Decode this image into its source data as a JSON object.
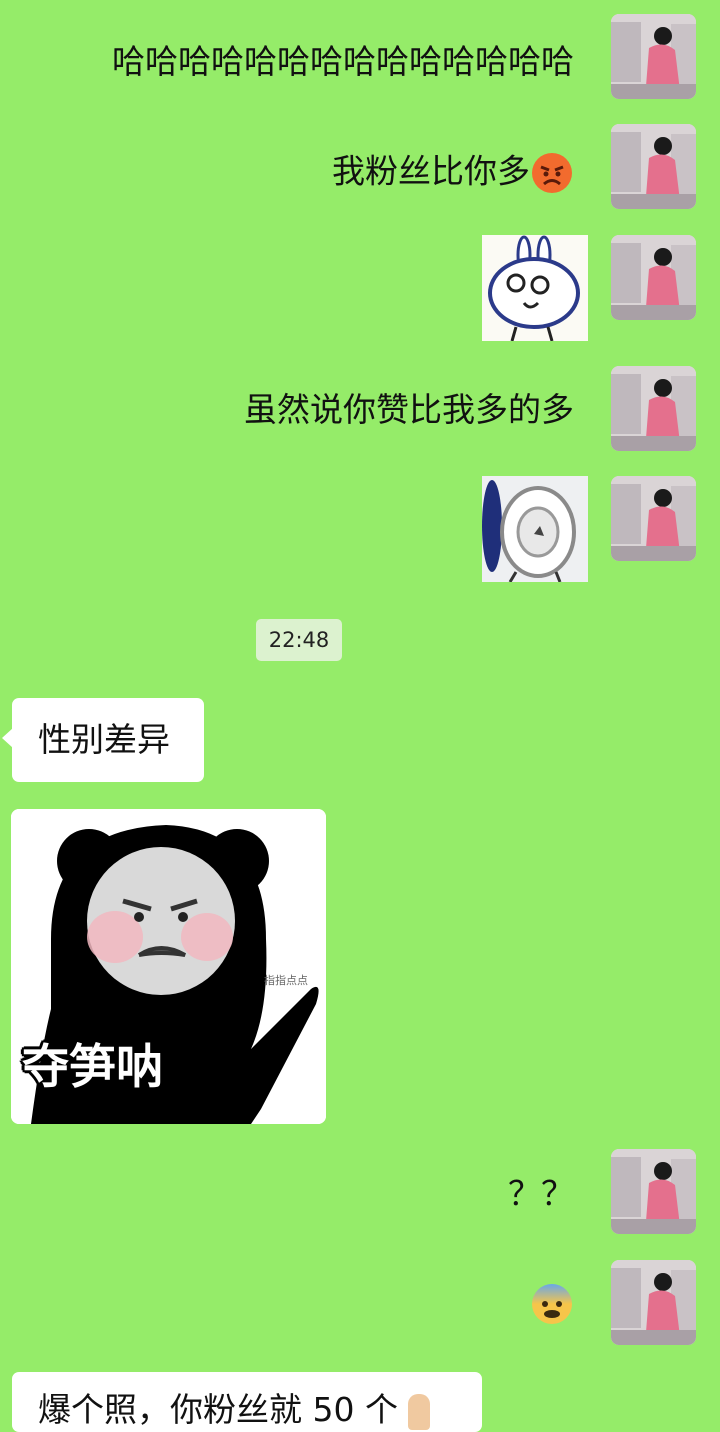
{
  "messages": {
    "m1_text": "哈哈哈哈哈哈哈哈哈哈哈哈哈哈",
    "m2_text": "我粉丝比你多",
    "m2_emoji": "angry-face",
    "m3_sticker": "rabbit-face-sticker",
    "m4_text": "虽然说你赞比我多的多",
    "m5_sticker": "rabbit-back-sticker",
    "timestamp": "22:48",
    "m6_text": "性别差异",
    "m7_meme_caption": "夺笋呐",
    "m7_meme_small": "指指点点",
    "m8_text": "？？",
    "m9_emoji": "fearful-face",
    "m10_text_partial": "爆个照，你粉丝就 50 个"
  },
  "colors": {
    "chat_bg": "#95ec69",
    "bubble_left": "#ffffff",
    "timestamp_bg": "#dcf2cf"
  },
  "icons": {
    "avatar": "user-avatar-photo",
    "pointing_hand": "pointing-up-hand-emoji"
  }
}
